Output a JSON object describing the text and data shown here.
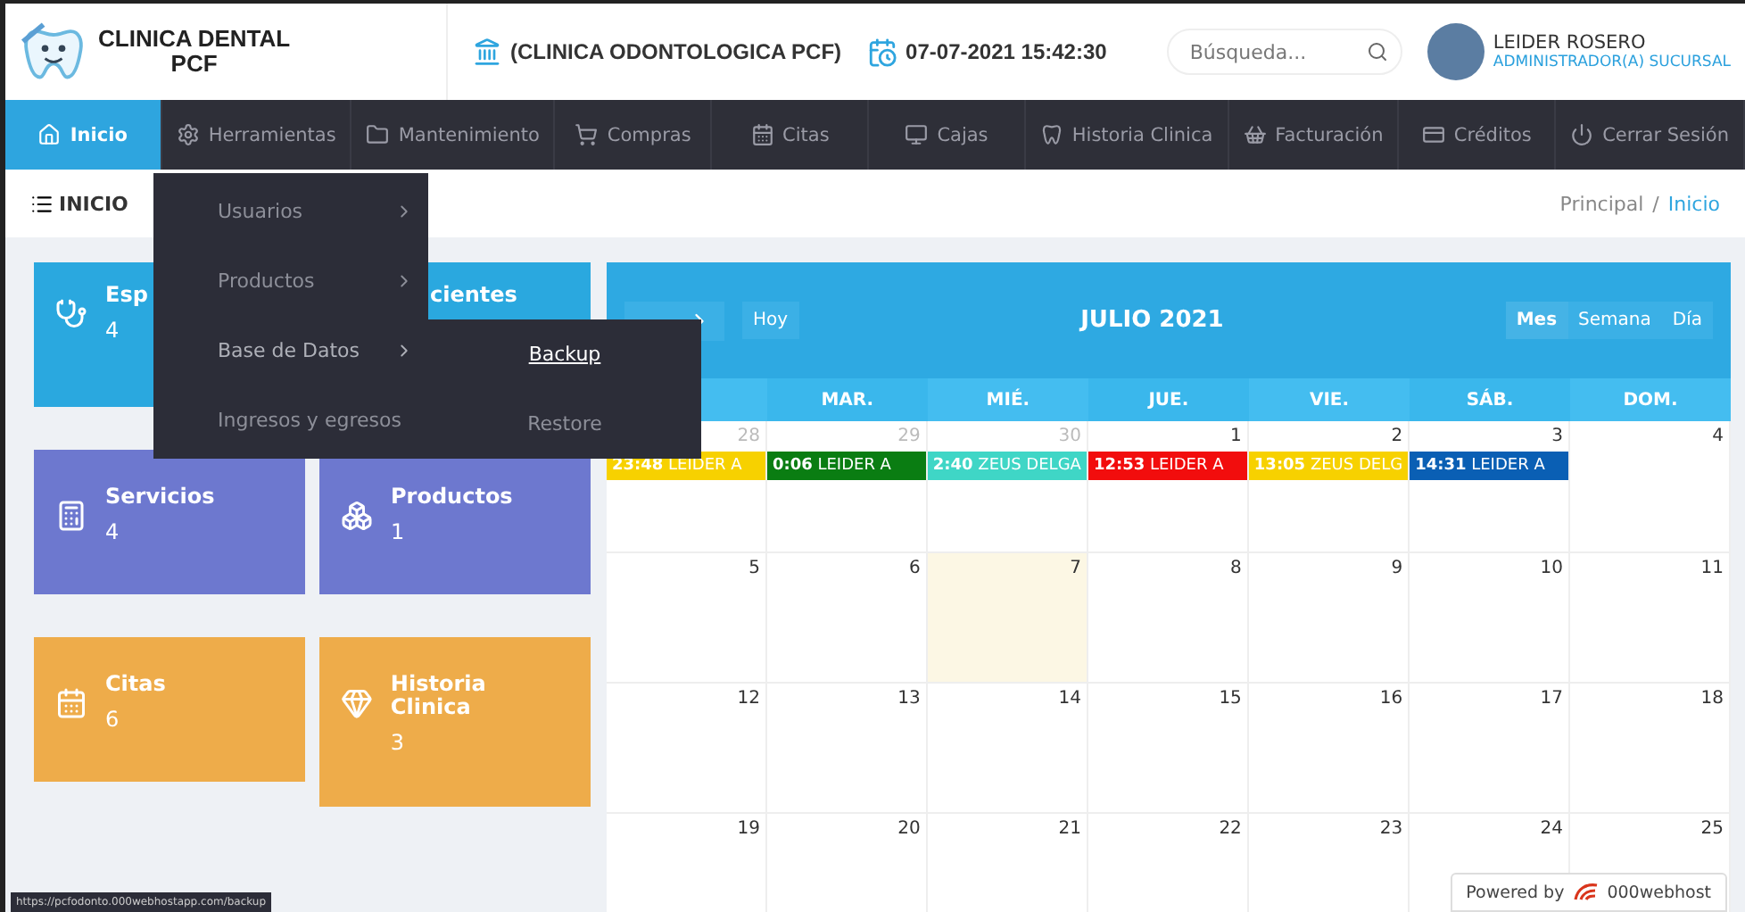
{
  "header": {
    "logo_line_1": "CLINICA DENTAL",
    "logo_line_2": "PCF",
    "branch": "(CLINICA ODONTOLOGICA PCF)",
    "datetime": "07-07-2021 15:42:30",
    "search": {
      "placeholder": "Búsqueda..."
    },
    "user": {
      "name": "LEIDER ROSERO",
      "role": "ADMINISTRADOR(A) SUCURSAL"
    }
  },
  "nav": [
    {
      "label": "Inicio",
      "selected": true
    },
    {
      "label": "Herramientas",
      "selected": false
    },
    {
      "label": "Mantenimiento",
      "selected": false
    },
    {
      "label": "Compras",
      "selected": false
    },
    {
      "label": "Citas",
      "selected": false
    },
    {
      "label": "Cajas",
      "selected": false
    },
    {
      "label": "Historia Clinica",
      "selected": false
    },
    {
      "label": "Facturación",
      "selected": false
    },
    {
      "label": "Créditos",
      "selected": false
    },
    {
      "label": "Cerrar Sesión",
      "selected": false
    }
  ],
  "menu": {
    "items": [
      {
        "label": "Usuarios",
        "submenu": true,
        "selected": false
      },
      {
        "label": "Productos",
        "submenu": true,
        "selected": false
      },
      {
        "label": "Base de Datos",
        "submenu": true,
        "selected": true
      },
      {
        "label": "Ingresos y egresos",
        "submenu": false,
        "selected": false
      }
    ],
    "subitems": [
      {
        "label": "Backup",
        "selected": true
      },
      {
        "label": "Restore",
        "selected": false
      }
    ]
  },
  "page_title": "INICIO",
  "breadcrumb": {
    "parent": "Principal",
    "separator": "/",
    "current": "Inicio"
  },
  "cards": [
    {
      "title": "Esp",
      "count": "4",
      "color": "#2aa8df"
    },
    {
      "title": "cientes",
      "color": "#2aa8df"
    },
    {
      "title": "Servicios",
      "count": "4",
      "color": "#6d78cf"
    },
    {
      "title": "Productos",
      "count": "1",
      "color": "#6d78cf"
    },
    {
      "title": "Citas",
      "count": "6",
      "color": "#eeac4a"
    },
    {
      "title": "Historia Clinica",
      "count": "3",
      "color": "#eeac4a"
    }
  ],
  "calendar": {
    "title": "JULIO 2021",
    "today_button": "Hoy",
    "views": [
      {
        "label": "Mes",
        "selected": true
      },
      {
        "label": "Semana",
        "selected": false
      },
      {
        "label": "Día",
        "selected": false
      }
    ],
    "weekdays": [
      "MAR.",
      "MIÉ.",
      "JUE.",
      "VIE.",
      "SÁB.",
      "DOM."
    ],
    "weeks": [
      [
        {
          "day": "28",
          "other_month": true,
          "today": false
        },
        {
          "day": "29",
          "other_month": true,
          "today": false
        },
        {
          "day": "30",
          "other_month": true,
          "today": false
        },
        {
          "day": "1",
          "other_month": false,
          "today": false
        },
        {
          "day": "2",
          "other_month": false,
          "today": false
        },
        {
          "day": "3",
          "other_month": false,
          "today": false
        },
        {
          "day": "4",
          "other_month": false,
          "today": false
        }
      ],
      [
        {
          "day": "5",
          "other_month": false,
          "today": false
        },
        {
          "day": "6",
          "other_month": false,
          "today": false
        },
        {
          "day": "7",
          "other_month": false,
          "today": true
        },
        {
          "day": "8",
          "other_month": false,
          "today": false
        },
        {
          "day": "9",
          "other_month": false,
          "today": false
        },
        {
          "day": "10",
          "other_month": false,
          "today": false
        },
        {
          "day": "11",
          "other_month": false,
          "today": false
        }
      ],
      [
        {
          "day": "12",
          "other_month": false,
          "today": false
        },
        {
          "day": "13",
          "other_month": false,
          "today": false
        },
        {
          "day": "14",
          "other_month": false,
          "today": false
        },
        {
          "day": "15",
          "other_month": false,
          "today": false
        },
        {
          "day": "16",
          "other_month": false,
          "today": false
        },
        {
          "day": "17",
          "other_month": false,
          "today": false
        },
        {
          "day": "18",
          "other_month": false,
          "today": false
        }
      ],
      [
        {
          "day": "19",
          "other_month": false,
          "today": false
        },
        {
          "day": "20",
          "other_month": false,
          "today": false
        },
        {
          "day": "21",
          "other_month": false,
          "today": false
        },
        {
          "day": "22",
          "other_month": false,
          "today": false
        },
        {
          "day": "23",
          "other_month": false,
          "today": false
        },
        {
          "day": "24",
          "other_month": false,
          "today": false
        },
        {
          "day": "25",
          "other_month": false,
          "today": false
        }
      ]
    ],
    "events": [
      {
        "time": "23:48",
        "title": "LEIDER A",
        "color": "#f7d100"
      },
      {
        "time": "0:06",
        "title": "LEIDER A",
        "color": "#0a7d12"
      },
      {
        "time": "2:40",
        "title": "ZEUS DELGA",
        "color": "#3fd6c6"
      },
      {
        "time": "12:53",
        "title": "LEIDER A",
        "color": "#f20d0d"
      },
      {
        "time": "13:05",
        "title": "ZEUS DELG",
        "color": "#f7d100"
      },
      {
        "time": "14:31",
        "title": "LEIDER A",
        "color": "#0a5fb4"
      }
    ]
  },
  "status_url": "https://pcfodonto.000webhostapp.com/backup",
  "powered_by": {
    "prefix": "Powered by",
    "brand": "000webhost"
  }
}
